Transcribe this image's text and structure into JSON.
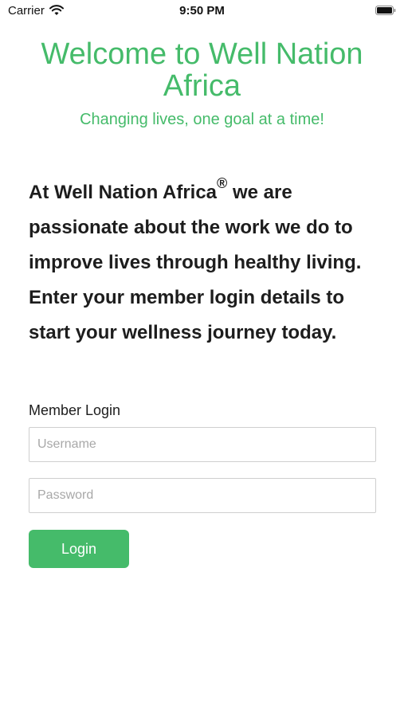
{
  "status_bar": {
    "carrier": "Carrier",
    "time": "9:50 PM",
    "wifi_icon": "wifi-icon",
    "battery_icon": "battery-icon"
  },
  "header": {
    "title": "Welcome to Well Nation Africa",
    "subtitle": "Changing lives, one goal at a time!"
  },
  "intro": {
    "brand": "At Well Nation Africa",
    "registered": "®",
    "text": " we are passionate about the work we do to improve lives through healthy living. Enter your member login details to start your wellness journey today."
  },
  "login": {
    "section_label": "Member Login",
    "username_placeholder": "Username",
    "username_value": "",
    "password_placeholder": "Password",
    "password_value": "",
    "button_label": "Login"
  },
  "colors": {
    "accent": "#45bb6a",
    "text": "#1d1d1d",
    "field_border": "#cfcfcf"
  }
}
